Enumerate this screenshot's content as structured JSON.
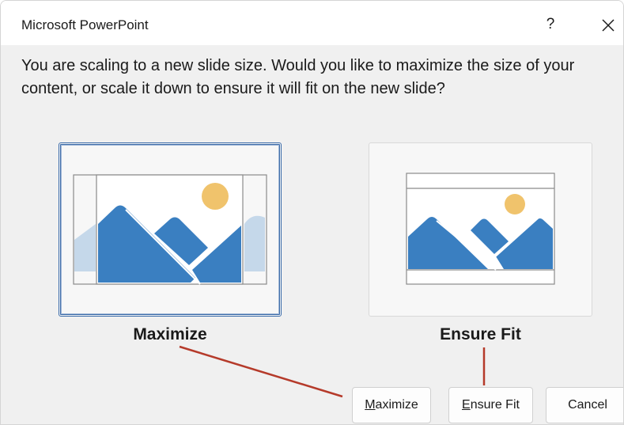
{
  "window": {
    "title": "Microsoft PowerPoint",
    "help_label": "?"
  },
  "message": "You are scaling to a new slide size.  Would you like to maximize the size of your content, or scale it down to ensure it will fit on the new slide?",
  "options": {
    "maximize": {
      "label": "Maximize",
      "selected": true
    },
    "ensure_fit": {
      "label": "Ensure Fit",
      "selected": false
    }
  },
  "buttons": {
    "maximize": {
      "mnemonic": "M",
      "rest": "aximize"
    },
    "ensure_fit": {
      "mnemonic": "E",
      "rest": "nsure Fit"
    },
    "cancel": {
      "label": "Cancel"
    }
  },
  "colors": {
    "accent": "#3a7fc1",
    "accent_light": "#c5d8ea",
    "sun": "#f0c36c",
    "annotation": "#b53a2a",
    "selection_border": "#3a6aa8"
  }
}
